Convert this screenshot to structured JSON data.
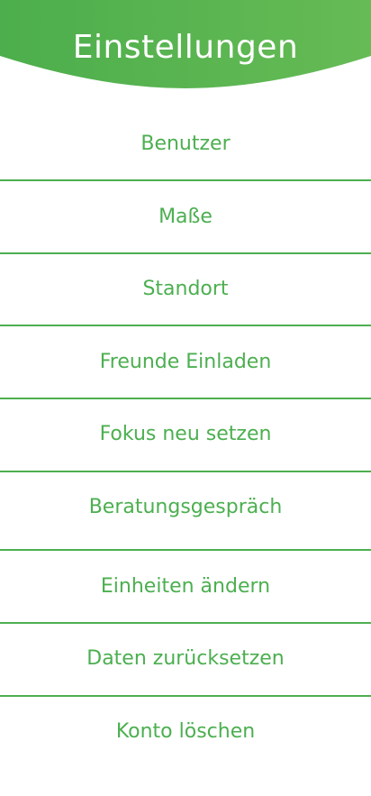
{
  "header": {
    "title": "Einstellungen",
    "gradient_left": "#4cae4c",
    "gradient_right": "#66bb55"
  },
  "accent_color": "#4caf50",
  "menu": {
    "items": [
      {
        "label": "Benutzer"
      },
      {
        "label": "Maße"
      },
      {
        "label": "Standort"
      },
      {
        "label": "Freunde Einladen"
      },
      {
        "label": "Fokus neu setzen"
      },
      {
        "label": "Beratungsgespräch"
      },
      {
        "label": "Einheiten ändern"
      },
      {
        "label": "Daten zurücksetzen"
      },
      {
        "label": "Konto löschen"
      }
    ]
  }
}
